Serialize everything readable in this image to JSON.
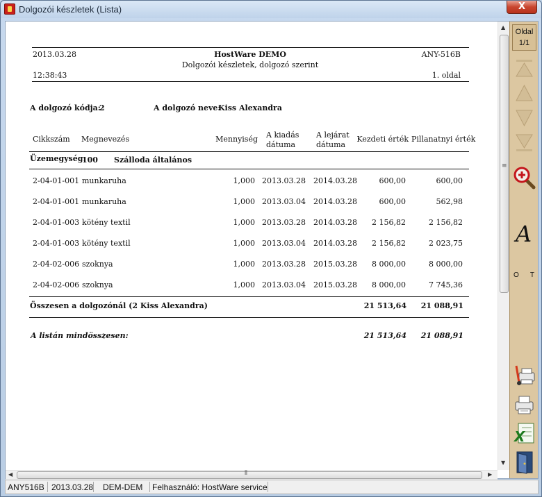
{
  "window": {
    "title": "Dolgozói készletek (Lista)",
    "close_label": "X"
  },
  "report": {
    "header": {
      "date": "2013.03.28",
      "company": "HostWare DEMO",
      "code": "ANY-516B",
      "subtitle": "Dolgozói készletek, dolgozó szerint",
      "time": "12:38:43",
      "page": "1. oldal"
    },
    "employee": {
      "code_label": "A dolgozó kódja:",
      "code": "2",
      "name_label": "A dolgozó neve:",
      "name": "Kiss Alexandra"
    },
    "columns": {
      "item_no": "Cikkszám",
      "name": "Megnevezés",
      "quantity": "Mennyiség",
      "issue_date_1": "A kiadás",
      "issue_date_2": "dátuma",
      "expiry_date_1": "A lejárat",
      "expiry_date_2": "dátuma",
      "initial_value": "Kezdeti érték",
      "current_value": "Pillanatnyi érték"
    },
    "unit": {
      "label": "Üzemegység:",
      "code": "100",
      "name": "Szálloda általános"
    },
    "rows": [
      {
        "item_no": "2-04-01-001",
        "name": "munkaruha",
        "quantity": "1,000",
        "issue_date": "2013.03.28",
        "expiry_date": "2014.03.28",
        "initial_value": "600,00",
        "current_value": "600,00"
      },
      {
        "item_no": "2-04-01-001",
        "name": "munkaruha",
        "quantity": "1,000",
        "issue_date": "2013.03.04",
        "expiry_date": "2014.03.28",
        "initial_value": "600,00",
        "current_value": "562,98"
      },
      {
        "item_no": "2-04-01-003",
        "name": "kötény textil",
        "quantity": "1,000",
        "issue_date": "2013.03.28",
        "expiry_date": "2014.03.28",
        "initial_value": "2 156,82",
        "current_value": "2 156,82"
      },
      {
        "item_no": "2-04-01-003",
        "name": "kötény textil",
        "quantity": "1,000",
        "issue_date": "2013.03.04",
        "expiry_date": "2014.03.28",
        "initial_value": "2 156,82",
        "current_value": "2 023,75"
      },
      {
        "item_no": "2-04-02-006",
        "name": "szoknya",
        "quantity": "1,000",
        "issue_date": "2013.03.28",
        "expiry_date": "2015.03.28",
        "initial_value": "8 000,00",
        "current_value": "8 000,00"
      },
      {
        "item_no": "2-04-02-006",
        "name": "szoknya",
        "quantity": "1,000",
        "issue_date": "2013.03.04",
        "expiry_date": "2015.03.28",
        "initial_value": "8 000,00",
        "current_value": "7 745,36"
      }
    ],
    "employee_total": {
      "label": "Összesen a dolgozónál (2 Kiss Alexandra)",
      "initial_value": "21 513,64",
      "current_value": "21 088,91"
    },
    "grand_total": {
      "label": "A listán mindösszesen:",
      "initial_value": "21 513,64",
      "current_value": "21 088,91"
    }
  },
  "toolbar": {
    "page_label": "Oldal",
    "page_value": "1/1",
    "o_label": "O",
    "t_label": "T",
    "icons": [
      "first-page-icon",
      "previous-page-icon",
      "next-page-icon",
      "last-page-icon",
      "zoom-in-icon",
      "font-icon",
      "printer-setup-icon",
      "print-icon",
      "excel-export-icon",
      "exit-door-icon"
    ]
  },
  "status": {
    "code": "ANY516B",
    "date": "2013.03.28",
    "database": "DEM-DEM",
    "user": "Felhasználó: HostWare service"
  }
}
